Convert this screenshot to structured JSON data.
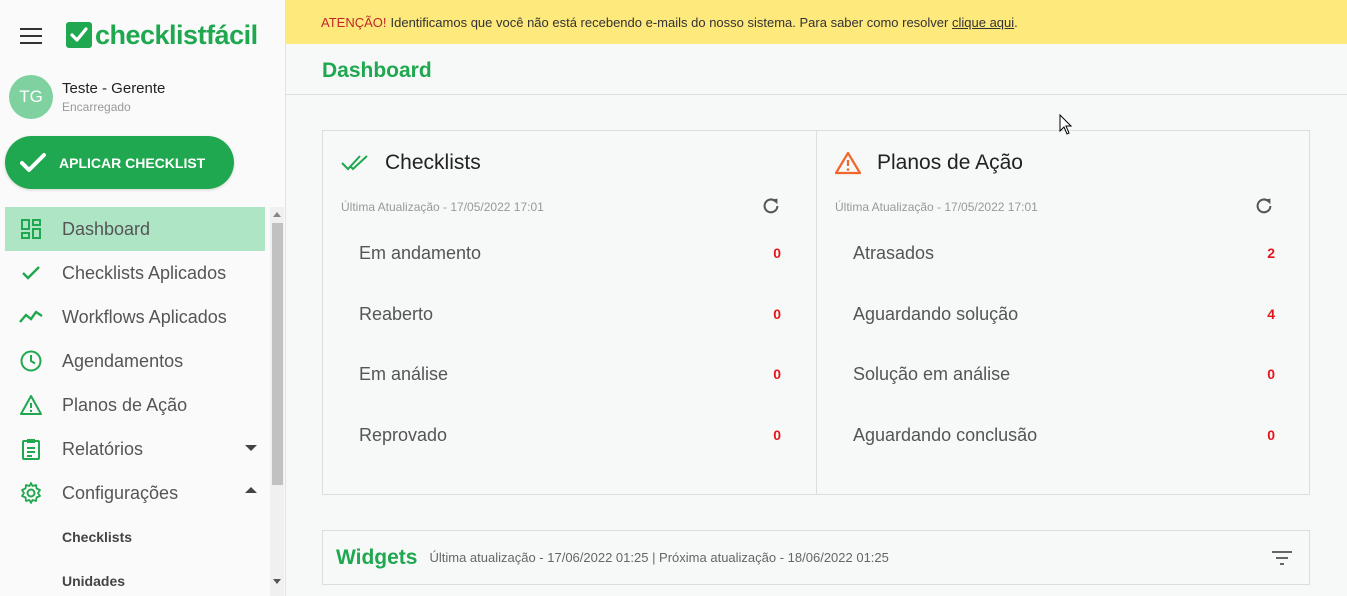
{
  "app": {
    "logo_text": "checklistfácil",
    "brand_color": "#1fa84f"
  },
  "user": {
    "initials": "TG",
    "name": "Teste - Gerente",
    "role": "Encarregado"
  },
  "sidebar": {
    "apply_button": "APLICAR CHECKLIST",
    "items": [
      {
        "label": "Dashboard",
        "icon": "dashboard-icon"
      },
      {
        "label": "Checklists Aplicados",
        "icon": "check-icon"
      },
      {
        "label": "Workflows Aplicados",
        "icon": "trend-icon"
      },
      {
        "label": "Agendamentos",
        "icon": "clock-icon"
      },
      {
        "label": "Planos de Ação",
        "icon": "warning-icon"
      },
      {
        "label": "Relatórios",
        "icon": "clipboard-icon"
      },
      {
        "label": "Configurações",
        "icon": "gear-icon"
      }
    ],
    "sub_items": [
      "Checklists",
      "Unidades"
    ]
  },
  "banner": {
    "prefix": "ATENÇÃO!",
    "message": "Identificamos que você não está recebendo e-mails do nosso sistema. Para saber como resolver",
    "link": "clique aqui",
    "suffix": "."
  },
  "page": {
    "title": "Dashboard"
  },
  "checklists_card": {
    "title": "Checklists",
    "updated": "Última Atualização - 17/05/2022 17:01",
    "rows": [
      {
        "label": "Em andamento",
        "value": "0"
      },
      {
        "label": "Reaberto",
        "value": "0"
      },
      {
        "label": "Em análise",
        "value": "0"
      },
      {
        "label": "Reprovado",
        "value": "0"
      }
    ]
  },
  "plans_card": {
    "title": "Planos de Ação",
    "updated": "Última Atualização - 17/05/2022 17:01",
    "rows": [
      {
        "label": "Atrasados",
        "value": "2"
      },
      {
        "label": "Aguardando solução",
        "value": "4"
      },
      {
        "label": "Solução em análise",
        "value": "0"
      },
      {
        "label": "Aguardando conclusão",
        "value": "0"
      }
    ]
  },
  "widgets": {
    "title": "Widgets",
    "info": "Última atualização - 17/06/2022 01:25 | Próxima atualização - 18/06/2022 01:25"
  }
}
